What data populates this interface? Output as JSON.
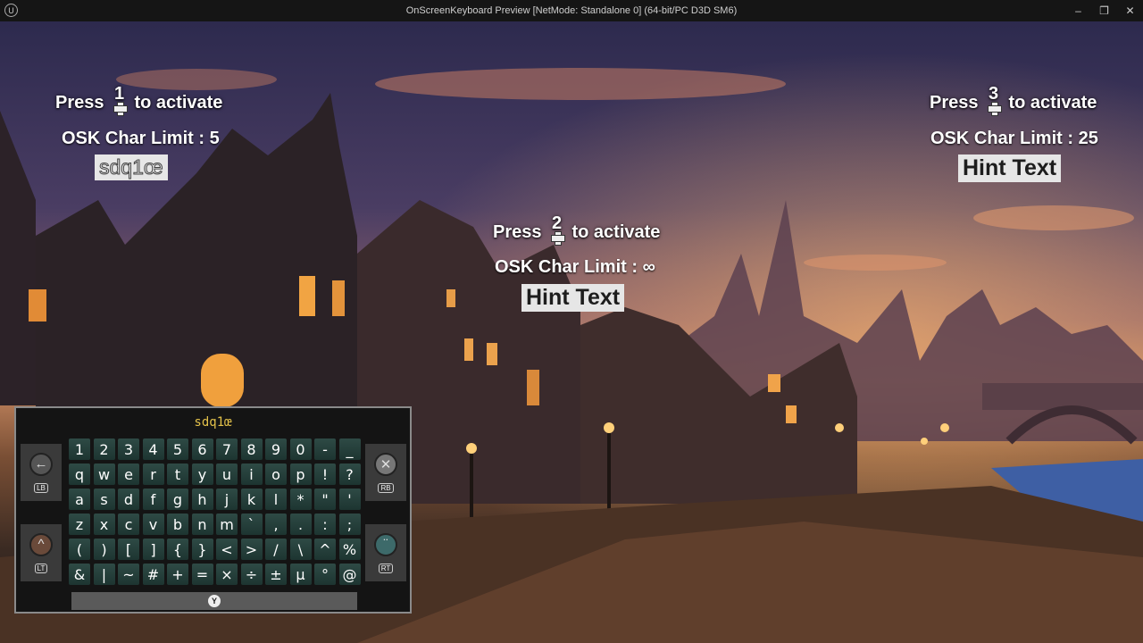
{
  "window": {
    "title": "OnScreenKeyboard Preview [NetMode: Standalone 0]  (64-bit/PC D3D SM6)",
    "minimize": "–",
    "restore": "❐",
    "close": "✕"
  },
  "prompts": [
    {
      "press": "Press",
      "number": "1",
      "activate": "to activate",
      "limit_label": "OSK Char Limit : 5",
      "text": "sdq1œ"
    },
    {
      "press": "Press",
      "number": "2",
      "activate": "to activate",
      "limit_label": "OSK Char Limit : ∞",
      "text": "Hint Text"
    },
    {
      "press": "Press",
      "number": "3",
      "activate": "to activate",
      "limit_label": "OSK Char Limit : 25",
      "text": "Hint Text"
    }
  ],
  "keyboard": {
    "entry": "sdq1œ",
    "rows": [
      [
        "1",
        "2",
        "3",
        "4",
        "5",
        "6",
        "7",
        "8",
        "9",
        "0",
        "-",
        "_"
      ],
      [
        "q",
        "w",
        "e",
        "r",
        "t",
        "y",
        "u",
        "i",
        "o",
        "p",
        "!",
        "?"
      ],
      [
        "a",
        "s",
        "d",
        "f",
        "g",
        "h",
        "j",
        "k",
        "l",
        "*",
        "\"",
        "'"
      ],
      [
        "z",
        "x",
        "c",
        "v",
        "b",
        "n",
        "m",
        "`",
        ",",
        ".",
        ":",
        ";"
      ],
      [
        "(",
        ")",
        "[",
        "]",
        "{",
        "}",
        "<",
        ">",
        "/",
        "\\",
        "^",
        "%"
      ],
      [
        "&",
        "|",
        "~",
        "#",
        "+",
        "=",
        "×",
        "÷",
        "±",
        "µ",
        "°",
        "@"
      ]
    ],
    "lb": "LB",
    "rb": "RB",
    "lt": "LT",
    "rt": "RT",
    "y_button": "Y",
    "icons": [
      "back-arrow-icon",
      "close-icon",
      "case-up-icon",
      "accent-icon"
    ]
  }
}
